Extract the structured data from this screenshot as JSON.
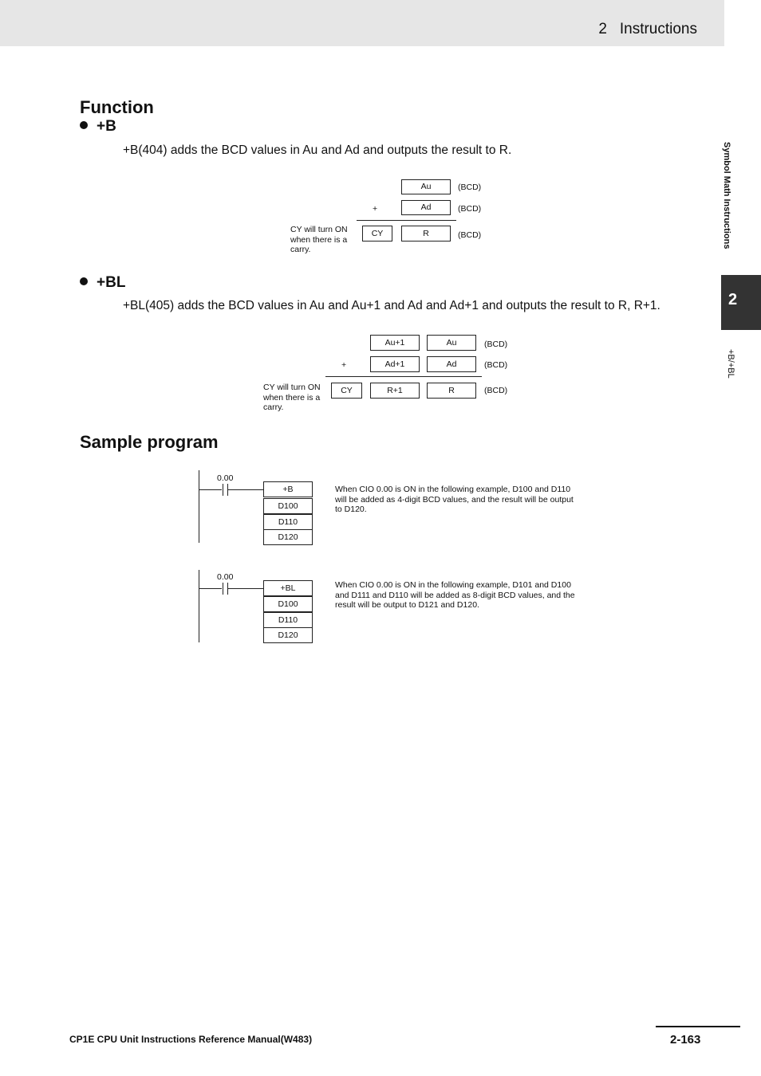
{
  "header": {
    "chapter_number": "2",
    "chapter_title": "Instructions"
  },
  "side_nav": {
    "section_label": "Symbol Math Instructions",
    "chapter_tab": "2",
    "sub_label": "+B/+BL"
  },
  "function_section": {
    "heading": "Function",
    "plus_b": {
      "title": "+B",
      "description": "+B(404) adds the BCD values in Au and Ad and outputs the result to R.",
      "diagram": {
        "operand1": "Au",
        "operand2": "Ad",
        "operator": "+",
        "carry": "CY",
        "result": "R",
        "unit": "(BCD)",
        "carry_note": "CY will turn ON when there is a carry."
      }
    },
    "plus_bl": {
      "title": "+BL",
      "description": "+BL(405) adds the BCD values in Au and Au+1 and Ad and Ad+1 and outputs the result to R, R+1.",
      "diagram": {
        "operand1_high": "Au+1",
        "operand1_low": "Au",
        "operand2_high": "Ad+1",
        "operand2_low": "Ad",
        "operator": "+",
        "carry": "CY",
        "result_high": "R+1",
        "result_low": "R",
        "unit": "(BCD)",
        "carry_note": "CY will turn ON when there is a carry."
      }
    }
  },
  "sample_section": {
    "heading": "Sample program",
    "examples": [
      {
        "contact": "0.00",
        "instruction": "+B",
        "operands": [
          "D100",
          "D110",
          "D120"
        ],
        "description": "When CIO 0.00 is ON in the following example, D100 and D110 will be added as 4-digit BCD values, and the result will be output to D120."
      },
      {
        "contact": "0.00",
        "instruction": "+BL",
        "operands": [
          "D100",
          "D110",
          "D120"
        ],
        "description": "When CIO 0.00 is ON in the following example, D101 and D100 and D111 and D110 will be added as 8-digit BCD values, and the result will be output to D121 and D120."
      }
    ]
  },
  "footer": {
    "manual_title": "CP1E CPU Unit Instructions Reference Manual(W483)",
    "page_number": "2-163"
  }
}
